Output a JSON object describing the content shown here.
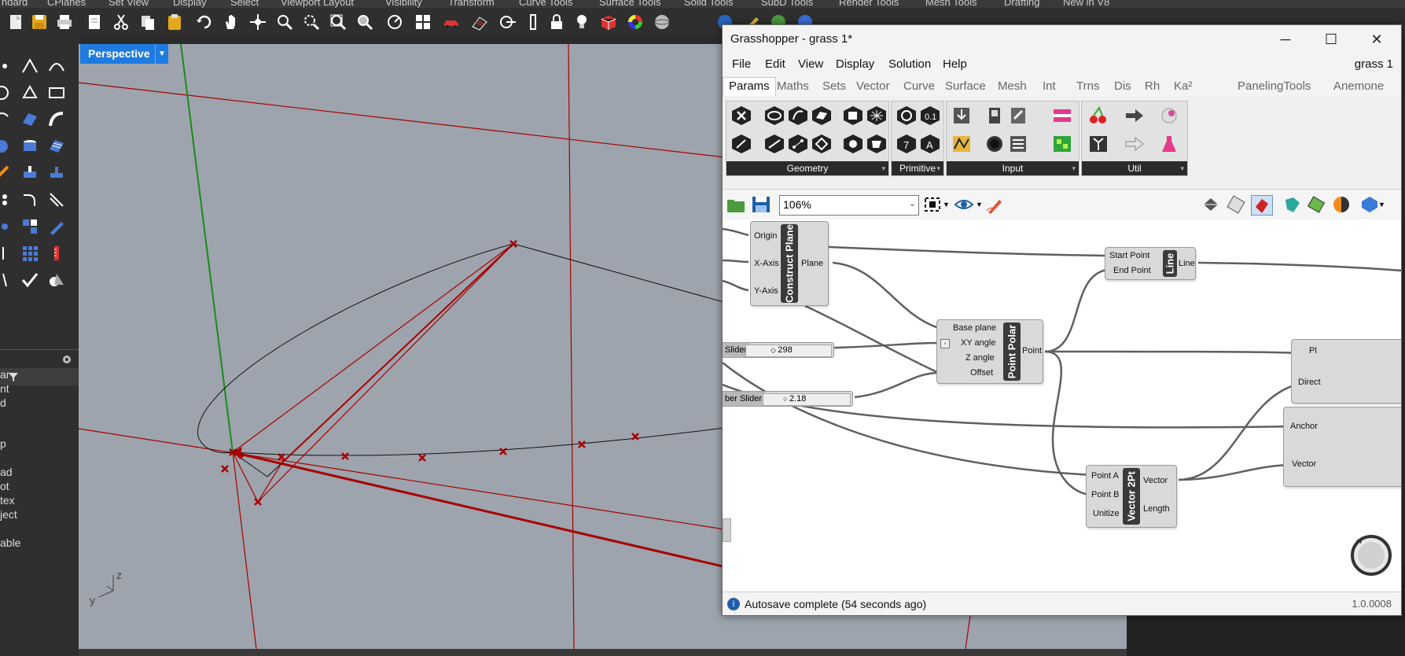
{
  "rhino": {
    "tabs": [
      "ndard",
      "CPlanes",
      "Set View",
      "Display",
      "Select",
      "Viewport Layout",
      "Visibility",
      "Transform",
      "Curve Tools",
      "Surface Tools",
      "Solid Tools",
      "SubD Tools",
      "Render Tools",
      "Mesh Tools",
      "Drafting",
      "New in V8"
    ],
    "viewport_label": "Perspective",
    "left_panel_texts": [
      "ar",
      "nt",
      "d",
      "p",
      "ad",
      "ot",
      "tex",
      "ject",
      "able"
    ],
    "axis_labels": {
      "z": "z",
      "y": "y"
    }
  },
  "gh": {
    "title": "Grasshopper - grass 1*",
    "doc_name": "grass 1",
    "menu": [
      "File",
      "Edit",
      "View",
      "Display",
      "Solution",
      "Help"
    ],
    "tabs": [
      "Params",
      "Maths",
      "Sets",
      "Vector",
      "Curve",
      "Surface",
      "Mesh",
      "Int",
      "Trns",
      "Dis",
      "Rh",
      "Ka²",
      "PanelingTools",
      "Anemone"
    ],
    "active_tab": "Params",
    "panels": [
      "Geometry",
      "Primitive",
      "Input",
      "Util"
    ],
    "zoom": "106%",
    "status": "Autosave complete (54 seconds ago)",
    "version": "1.0.0008",
    "components": {
      "construct_plane": {
        "name": "Construct Plane",
        "inputs": [
          "Origin",
          "X-Axis",
          "Y-Axis"
        ],
        "outputs": [
          "Plane"
        ]
      },
      "line": {
        "name": "Line",
        "inputs": [
          "Start Point",
          "End Point"
        ],
        "outputs": [
          "Line"
        ]
      },
      "point_polar": {
        "name": "Point Polar",
        "inputs": [
          "Base plane",
          "XY angle",
          "Z angle",
          "Offset"
        ],
        "outputs": [
          "Point"
        ]
      },
      "vector2pt": {
        "name": "Vector 2Pt",
        "inputs": [
          "Point A",
          "Point B",
          "Unitize"
        ],
        "outputs": [
          "Vector",
          "Length"
        ]
      },
      "right_partial_1": {
        "outputs": [
          "Pl",
          "Direct"
        ]
      },
      "right_partial_2": {
        "inputs": [
          "Anchor",
          "Vector"
        ]
      }
    },
    "sliders": [
      {
        "name": "Slider",
        "value": "298"
      },
      {
        "name": "ber Slider",
        "value": "2.18"
      }
    ]
  }
}
